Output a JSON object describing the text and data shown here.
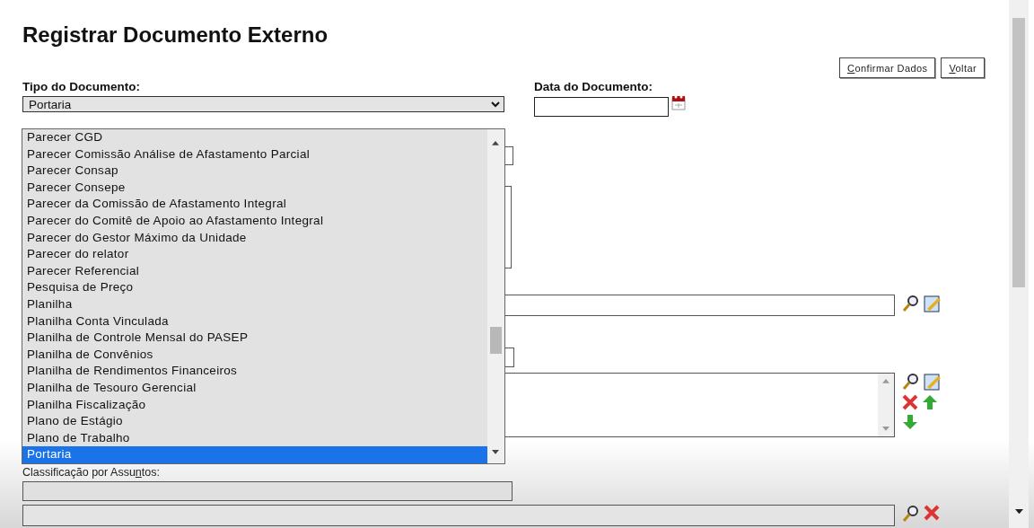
{
  "title": "Registrar Documento Externo",
  "buttons": [
    {
      "label": "Confirmar Dados"
    },
    {
      "label": "Voltar"
    }
  ],
  "document_type": {
    "label": "Tipo do Documento:",
    "value": "Portaria",
    "expanded": true,
    "options": [
      {
        "label": "Parecer CGD",
        "selected": false
      },
      {
        "label": "Parecer Comissão Análise de Afastamento Parcial",
        "selected": false
      },
      {
        "label": "Parecer Consap",
        "selected": false
      },
      {
        "label": "Parecer Consepe",
        "selected": false
      },
      {
        "label": "Parecer da Comissão de Afastamento Integral",
        "selected": false
      },
      {
        "label": "Parecer do Comitê de Apoio ao Afastamento Integral",
        "selected": false
      },
      {
        "label": "Parecer do Gestor Máximo da Unidade",
        "selected": false
      },
      {
        "label": "Parecer do relator",
        "selected": false
      },
      {
        "label": "Parecer Referencial",
        "selected": false
      },
      {
        "label": "Pesquisa de Preço",
        "selected": false
      },
      {
        "label": "Planilha",
        "selected": false
      },
      {
        "label": "Planilha Conta Vinculada",
        "selected": false
      },
      {
        "label": "Planilha de Controle Mensal do PASEP",
        "selected": false
      },
      {
        "label": "Planilha de Convênios",
        "selected": false
      },
      {
        "label": "Planilha de Rendimentos Financeiros",
        "selected": false
      },
      {
        "label": "Planilha de Tesouro Gerencial",
        "selected": false
      },
      {
        "label": "Planilha Fiscalização",
        "selected": false
      },
      {
        "label": "Plano de Estágio",
        "selected": false
      },
      {
        "label": "Plano de Trabalho",
        "selected": false
      },
      {
        "label": "Portaria",
        "selected": true
      }
    ]
  },
  "document_date": {
    "label": "Data do Documento:"
  },
  "classification": {
    "label": "Classificação por Assuntos:"
  }
}
